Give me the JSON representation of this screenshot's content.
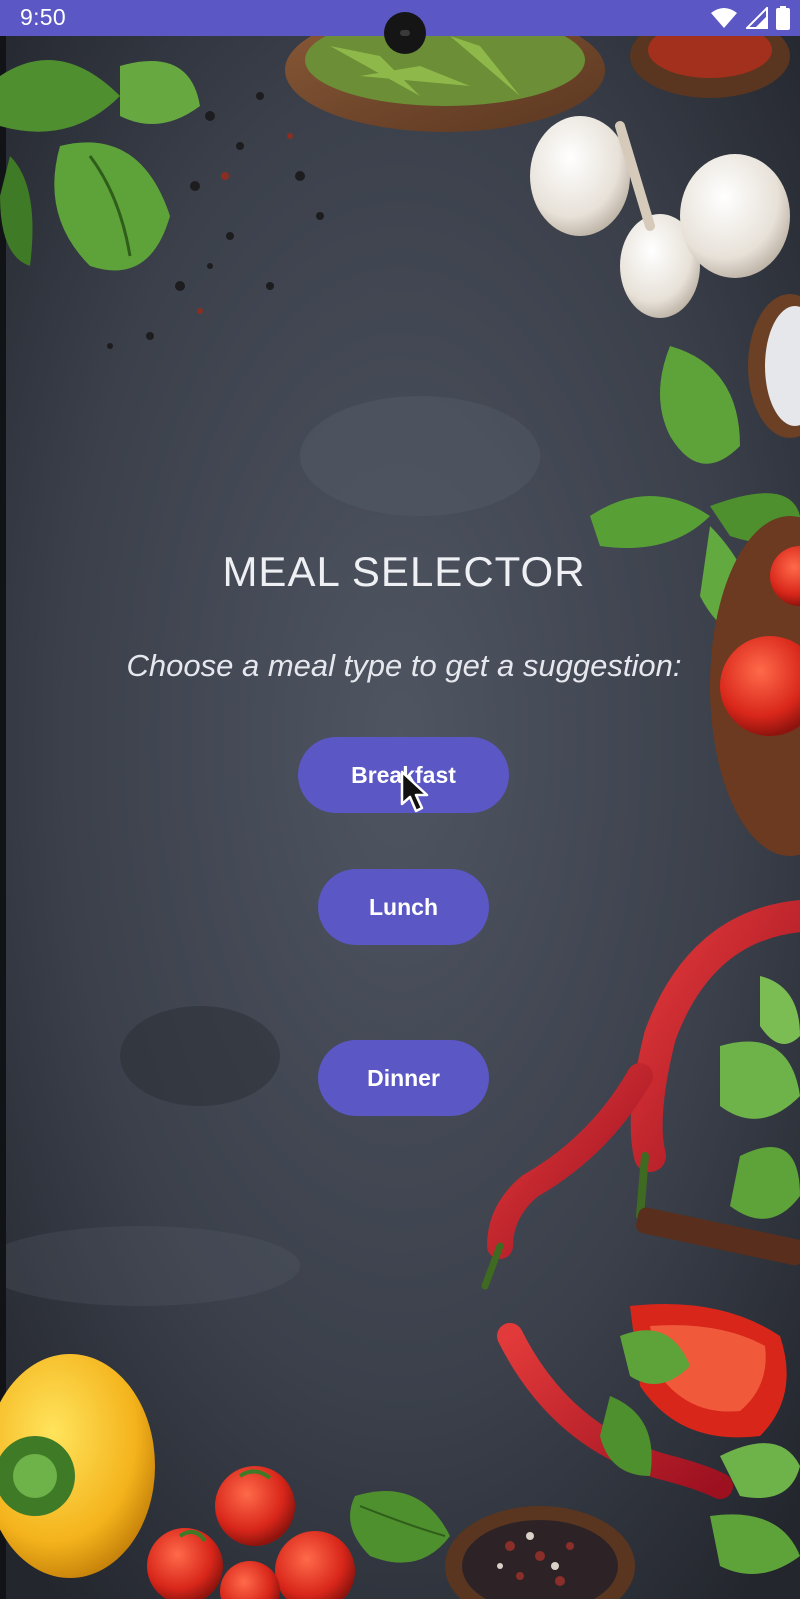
{
  "status_bar": {
    "time": "9:50",
    "background_color": "#5b57c4",
    "icons": [
      "wifi-icon",
      "cellular-signal-icon",
      "battery-icon"
    ]
  },
  "main": {
    "title": "MEAL SELECTOR",
    "subtitle": "Choose a meal type to get a suggestion:",
    "buttons": [
      {
        "label": "Breakfast"
      },
      {
        "label": "Lunch"
      },
      {
        "label": "Dinner"
      }
    ],
    "accent_color": "#5b57c4"
  }
}
